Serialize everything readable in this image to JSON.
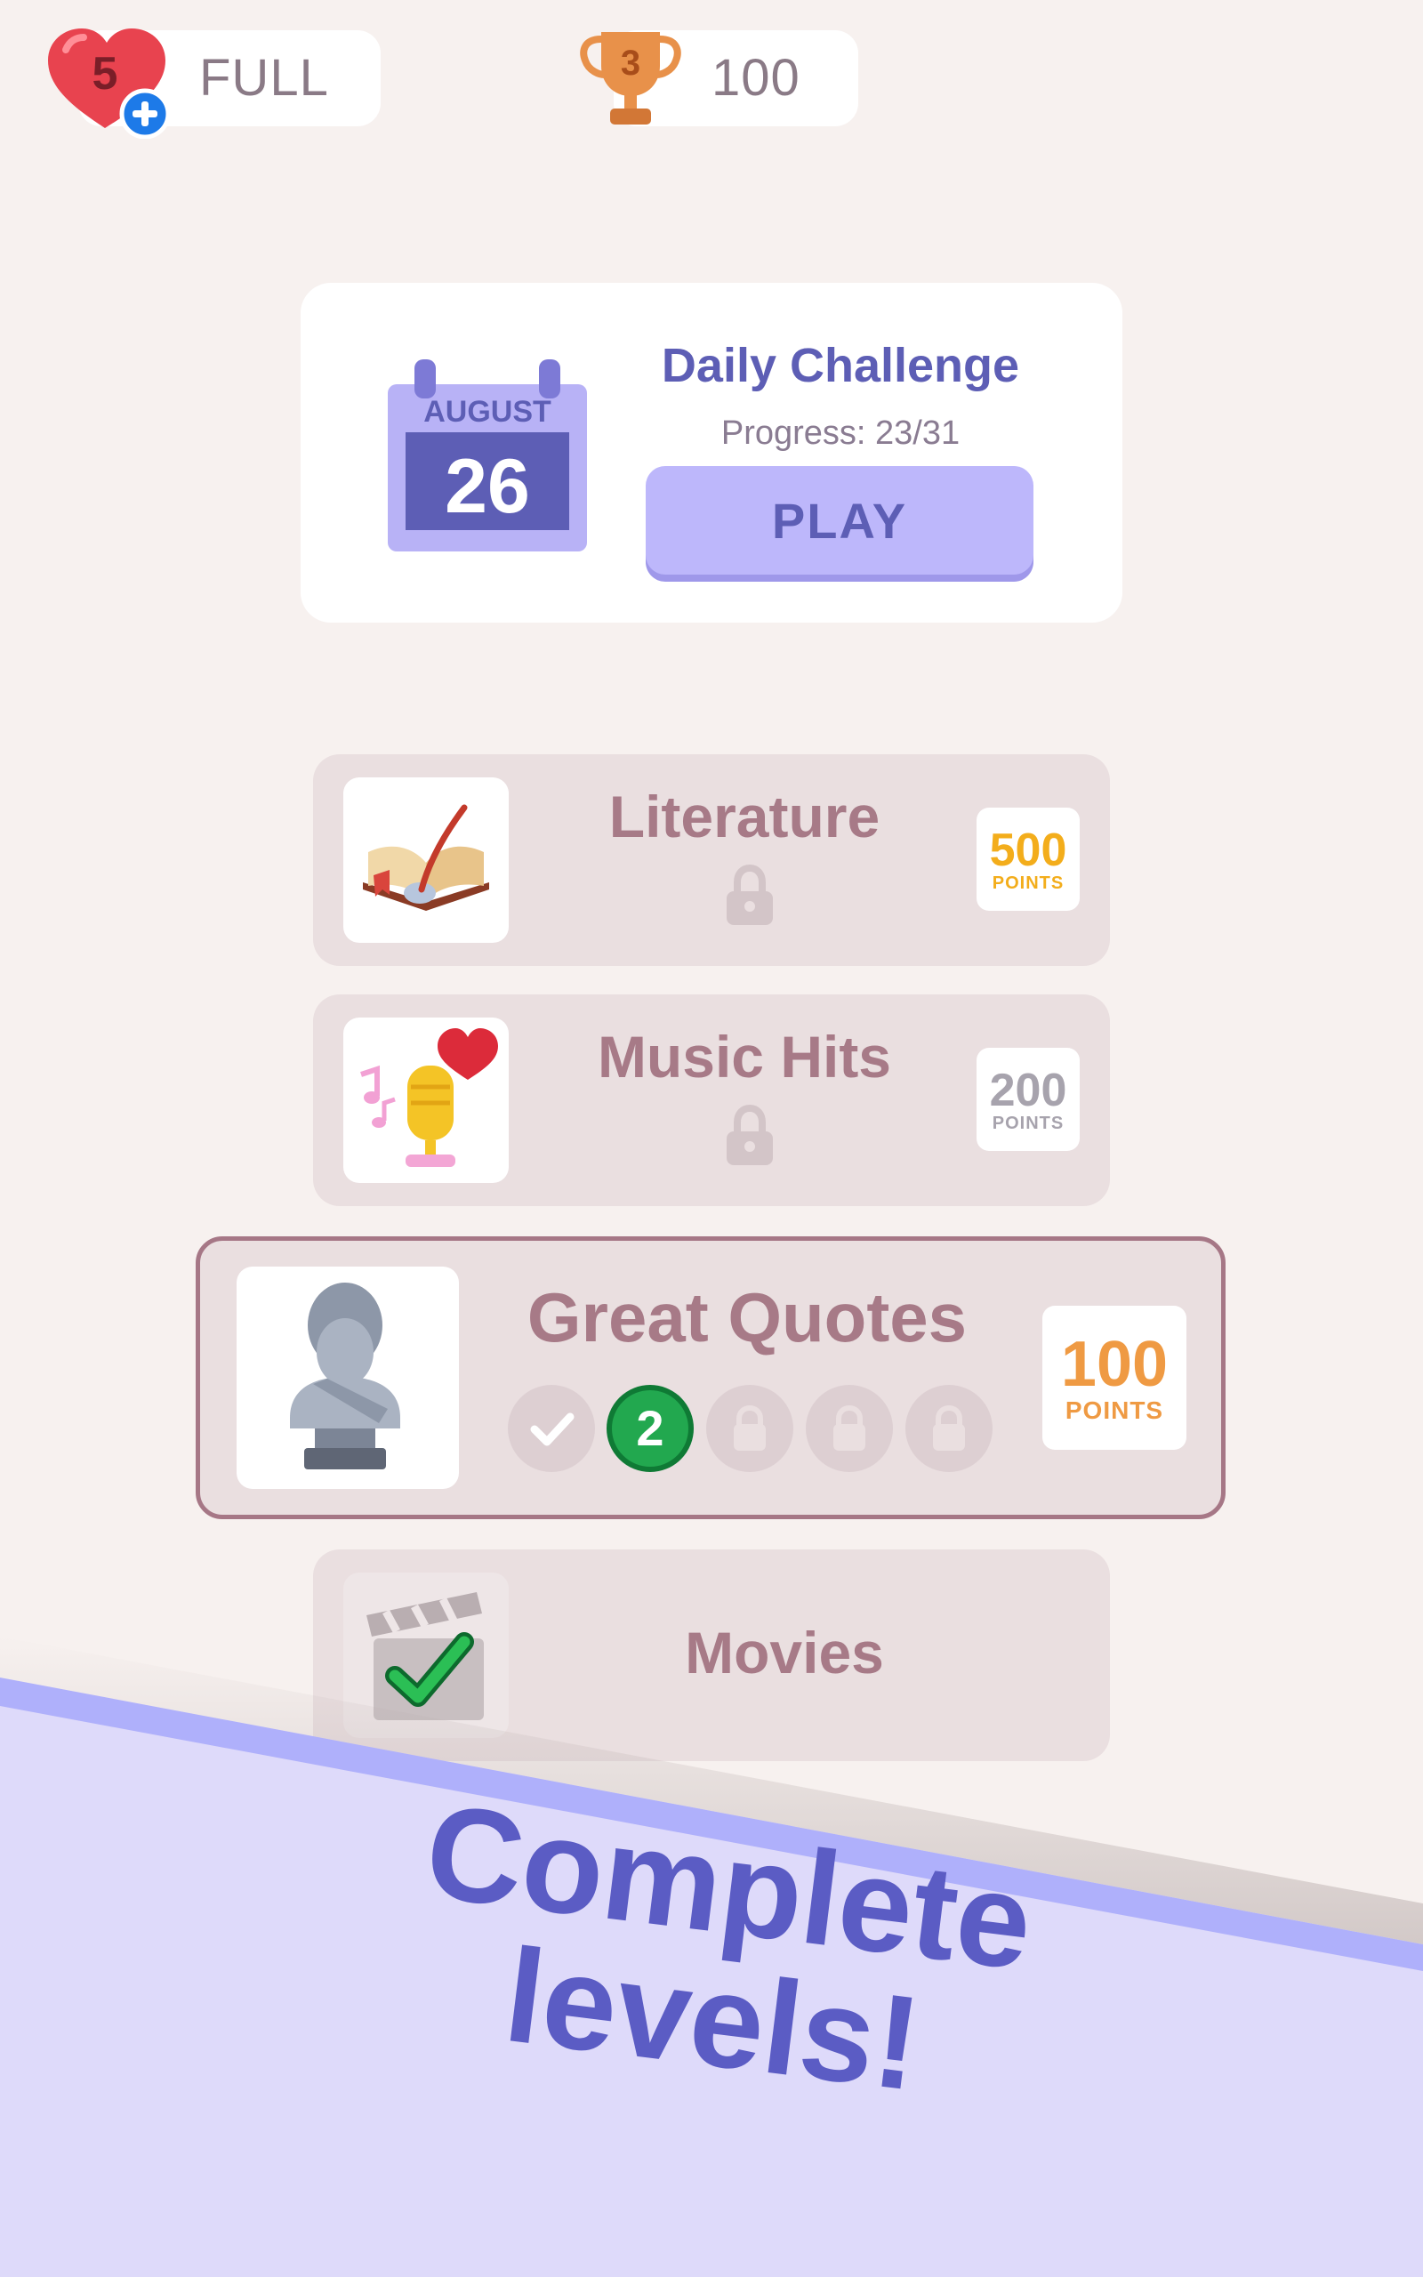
{
  "header": {
    "lives_count": "5",
    "lives_label": "FULL",
    "trophy_rank": "3",
    "score": "100"
  },
  "daily_challenge": {
    "month": "AUGUST",
    "day": "26",
    "title": "Daily Challenge",
    "progress": "Progress: 23/31",
    "play_label": "PLAY"
  },
  "levels": [
    {
      "title": "Literature",
      "points": "500",
      "points_label": "POINTS",
      "locked": true
    },
    {
      "title": "Music Hits",
      "points": "200",
      "points_label": "POINTS",
      "locked": true
    },
    {
      "title": "Great Quotes",
      "points": "100",
      "points_label": "POINTS",
      "locked": false,
      "current_step": "2"
    },
    {
      "title": "Movies",
      "completed": true
    }
  ],
  "banner": {
    "line1": "Complete",
    "line2": "levels!"
  },
  "colors": {
    "background": "#f7f1ef",
    "accent": "#5d5eb5",
    "card": "#eadfe0",
    "banner": "#dcd8fa"
  }
}
